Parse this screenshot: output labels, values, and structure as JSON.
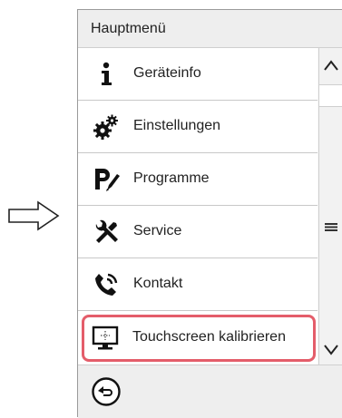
{
  "header": {
    "title": "Hauptmenü"
  },
  "menu": {
    "items": [
      {
        "label": "Geräteinfo",
        "icon": "info-icon"
      },
      {
        "label": "Einstellungen",
        "icon": "gears-icon"
      },
      {
        "label": "Programme",
        "icon": "program-edit-icon"
      },
      {
        "label": "Service",
        "icon": "service-tools-icon"
      },
      {
        "label": "Kontakt",
        "icon": "phone-icon"
      },
      {
        "label": "Touchscreen kalibrieren",
        "icon": "touchscreen-calibrate-icon",
        "highlighted": true
      }
    ]
  },
  "colors": {
    "highlight": "#e45d6a",
    "panel_bg": "#f7f7f7",
    "item_bg": "#ffffff"
  },
  "icons": {
    "pointer": "right-arrow-outline-icon",
    "scroll_up": "chevron-up-icon",
    "scroll_handle": "drag-lines-icon",
    "scroll_down": "chevron-down-icon",
    "back": "back-arrow-icon"
  }
}
